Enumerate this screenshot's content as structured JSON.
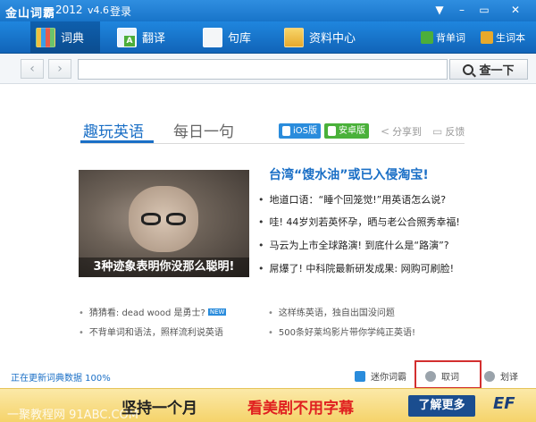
{
  "titlebar": {
    "title": "金山词霸",
    "year": "2012",
    "version": "v4.6",
    "login": "登录",
    "buttons": {
      "menu": "▼",
      "minimize": "–",
      "restore": "▭",
      "close": "✕"
    }
  },
  "nav": {
    "tabs": [
      {
        "label": "词典",
        "icon": "book-icon",
        "active": true
      },
      {
        "label": "翻译",
        "icon": "translate-icon",
        "active": false
      },
      {
        "label": "句库",
        "icon": "document-icon",
        "active": false
      },
      {
        "label": "资料中心",
        "icon": "folder-icon",
        "active": false
      }
    ],
    "vocab": "背单词",
    "wordbook": "生词本"
  },
  "search": {
    "back": "‹",
    "forward": "›",
    "value": "",
    "placeholder": "",
    "button": "查一下"
  },
  "content": {
    "tabs": [
      "趣玩英语",
      "每日一句"
    ],
    "ios_label": "iOS版",
    "android_label": "安卓版",
    "share_label": "分享到",
    "feedback_label": "反馈",
    "hero_caption": "3种迹象表明你没那么聪明!",
    "headline": "台湾“馊水油”或已入侵淘宝!",
    "articles": [
      "地道口语：“睡个回笼觉!”用英语怎么说?",
      "哇! 44岁刘若英怀孕，晒与老公合照秀幸福!",
      "马云为上市全球路演! 到底什么是“路演”?",
      "屌爆了! 中科院最新研发成果: 网购可刷脸!"
    ],
    "tips_left": [
      "猜猜看: dead wood 是勇士?",
      "不背单词和语法，照样流利说英语"
    ],
    "tips_right": [
      "这样练英语，独自出国没问题",
      "500条好莱坞影片带你学纯正英语!"
    ],
    "new_badge": "NEW"
  },
  "status": {
    "update_text": "正在更新词典数据 100%",
    "mini": "迷你词霸",
    "cancel": "取词",
    "translate": "划译"
  },
  "ad": {
    "main": "坚持一个月",
    "highlight": "看美剧不用字幕",
    "button": "了解更多",
    "logo": "EF",
    "watermark": "一聚教程网 91ABC.COM"
  },
  "colors": {
    "accent": "#1a6fc6",
    "titlebar": "#1874c9",
    "highlight_box": "#d32f2f",
    "ad_bg": "#f5d36a"
  }
}
